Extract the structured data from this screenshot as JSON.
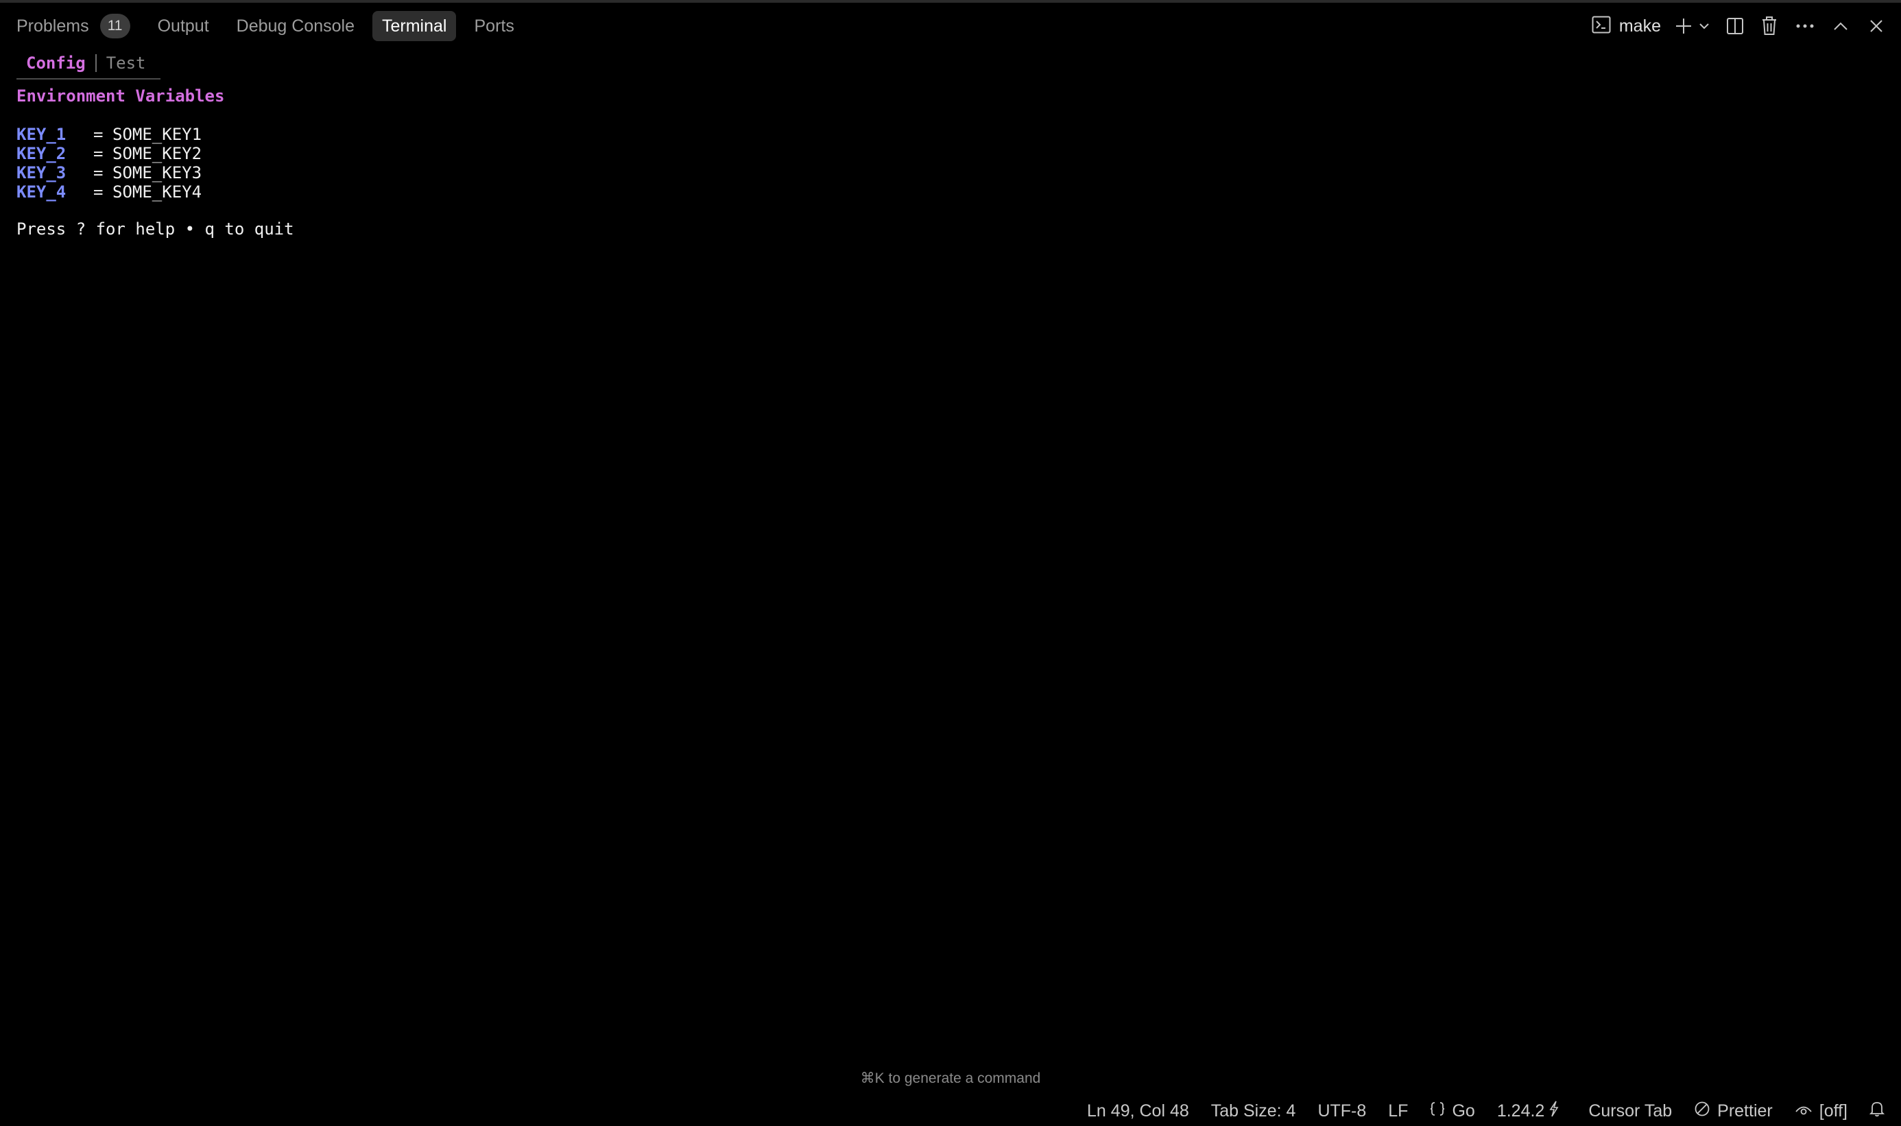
{
  "panel": {
    "tabs": [
      {
        "label": "Problems",
        "badge": "11"
      },
      {
        "label": "Output"
      },
      {
        "label": "Debug Console"
      },
      {
        "label": "Terminal",
        "active": true
      },
      {
        "label": "Ports"
      }
    ],
    "terminal_name": "make",
    "icons": [
      "terminal-icon",
      "plus-icon",
      "chevron-down-icon",
      "split-icon",
      "trash-icon",
      "more-icon",
      "chevron-up-icon",
      "close-icon"
    ]
  },
  "terminal": {
    "subtabs": [
      {
        "label": "Config",
        "active": true
      },
      {
        "label": "Test",
        "active": false
      }
    ],
    "section_title": "Environment Variables",
    "env": [
      {
        "key": "KEY_1",
        "eq": "=",
        "value": "SOME_KEY1"
      },
      {
        "key": "KEY_2",
        "eq": "=",
        "value": "SOME_KEY2"
      },
      {
        "key": "KEY_3",
        "eq": "=",
        "value": "SOME_KEY3"
      },
      {
        "key": "KEY_4",
        "eq": "=",
        "value": "SOME_KEY4"
      }
    ],
    "help_text": "Press ? for help • q to quit"
  },
  "hint": "⌘K to generate a command",
  "statusbar": {
    "position": "Ln 49, Col 48",
    "tab_size": "Tab Size: 4",
    "encoding": "UTF-8",
    "eol": "LF",
    "language": "Go",
    "version": "1.24.2",
    "cursor_tab": "Cursor Tab",
    "prettier": "Prettier",
    "copilot": "[off]"
  },
  "colors": {
    "accent_magenta": "#d46fe0",
    "key_blue": "#7c8cff",
    "background": "#000000"
  }
}
